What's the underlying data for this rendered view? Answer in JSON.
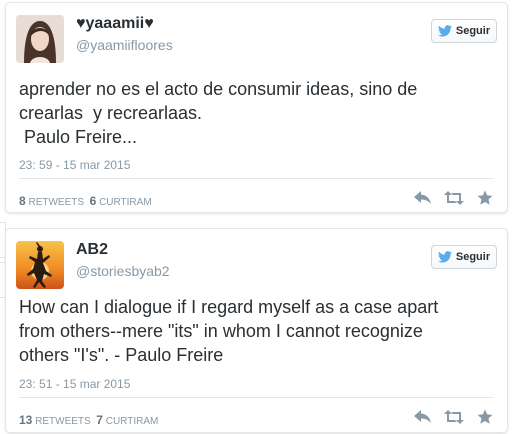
{
  "tweets": [
    {
      "display_name": "♥yaaamii♥",
      "handle": "@yaamiifloores",
      "follow_label": "Seguir",
      "text": "aprender no es el acto de consumir ideas, sino de\ncrearlas  y recrearlaas.\n Paulo Freire...",
      "timestamp": "23: 59 - 15 mar 2015",
      "retweets_count": "8",
      "retweets_label": "RETWEETS",
      "likes_count": "6",
      "likes_label": "CURTIRAM"
    },
    {
      "display_name": "AB2",
      "handle": "@storiesbyab2",
      "follow_label": "Seguir",
      "text": "How can I dialogue if I regard myself as a case apart\nfrom others--mere \"its\" in whom I cannot recognize\nothers \"I's\". - Paulo Freire",
      "timestamp": "23: 51 - 15 mar 2015",
      "retweets_count": "13",
      "retweets_label": "RETWEETS",
      "likes_count": "7",
      "likes_label": "CURTIRAM"
    }
  ],
  "colors": {
    "twitter_blue": "#55acee",
    "muted": "#8899a6",
    "text": "#292f33",
    "border": "#e1e8ed"
  },
  "icons": {
    "follow": "twitter-bird-icon",
    "reply": "reply-icon",
    "retweet": "retweet-icon",
    "favorite": "star-icon"
  }
}
